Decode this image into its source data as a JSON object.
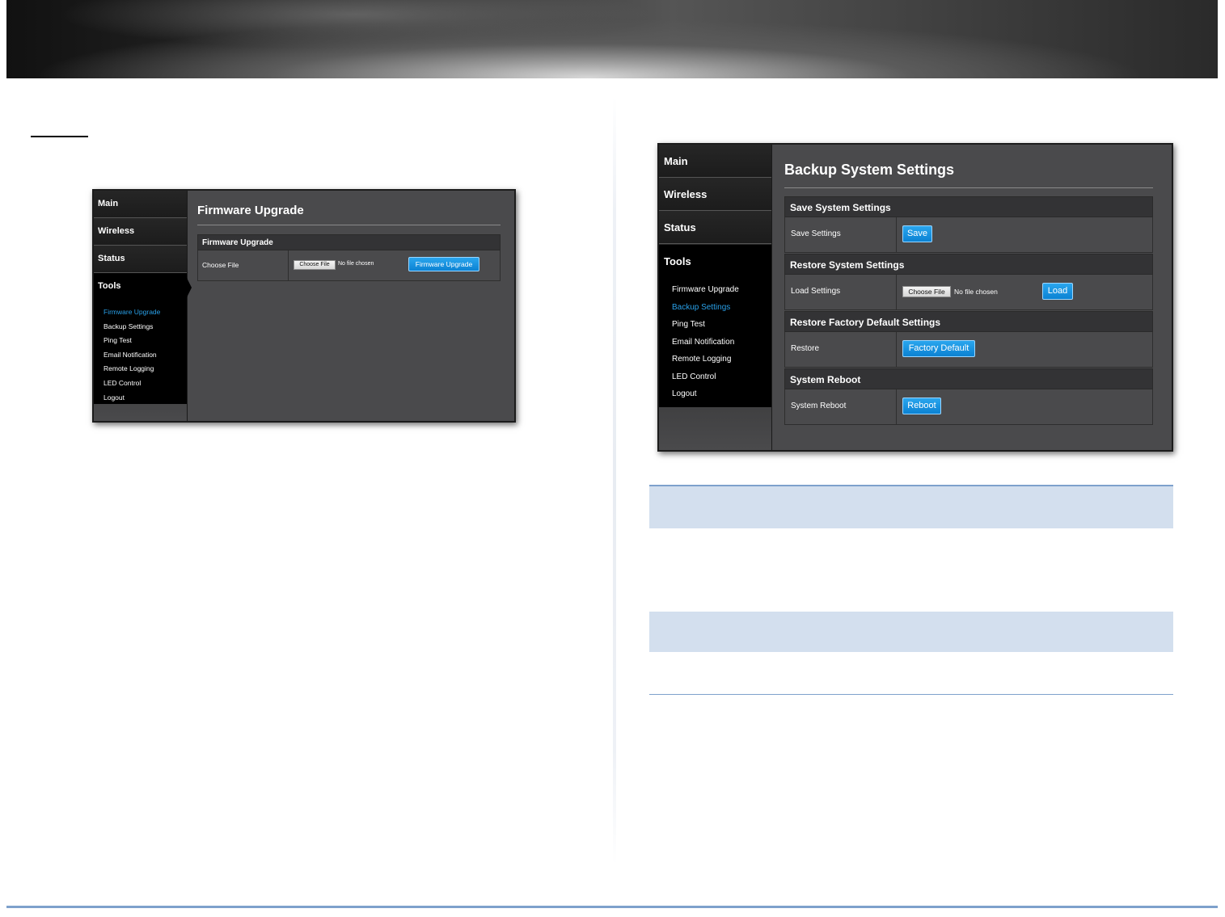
{
  "nav": {
    "main": "Main",
    "wireless": "Wireless",
    "status": "Status",
    "tools": "Tools",
    "tools_items": [
      "Firmware Upgrade",
      "Backup Settings",
      "Ping Test",
      "Email Notification",
      "Remote Logging",
      "LED Control",
      "Logout"
    ]
  },
  "firmware_screen": {
    "title": "Firmware Upgrade",
    "section_title": "Firmware Upgrade",
    "row_label": "Choose File",
    "choose_file": "Choose File",
    "file_status": "No file chosen",
    "upgrade_button": "Firmware Upgrade",
    "current_menu_item": "Firmware Upgrade"
  },
  "backup_screen": {
    "title": "Backup System Settings",
    "current_menu_item": "Backup Settings",
    "save_section": {
      "title": "Save System Settings",
      "label": "Save Settings",
      "button": "Save"
    },
    "restore_section": {
      "title": "Restore System Settings",
      "label": "Load Settings",
      "choose_file": "Choose File",
      "file_status": "No file chosen",
      "button": "Load"
    },
    "factory_section": {
      "title": "Restore Factory Default Settings",
      "label": "Restore",
      "button": "Factory Default"
    },
    "reboot_section": {
      "title": "System Reboot",
      "label": "System Reboot",
      "button": "Reboot"
    }
  },
  "colors": {
    "accent_blue": "#0b82d3",
    "active_menu_text": "#29a0e8",
    "panel_background": "#4a4a4c",
    "note_box_fill": "#d3dfee",
    "rule_blue": "#7ea1cc"
  }
}
